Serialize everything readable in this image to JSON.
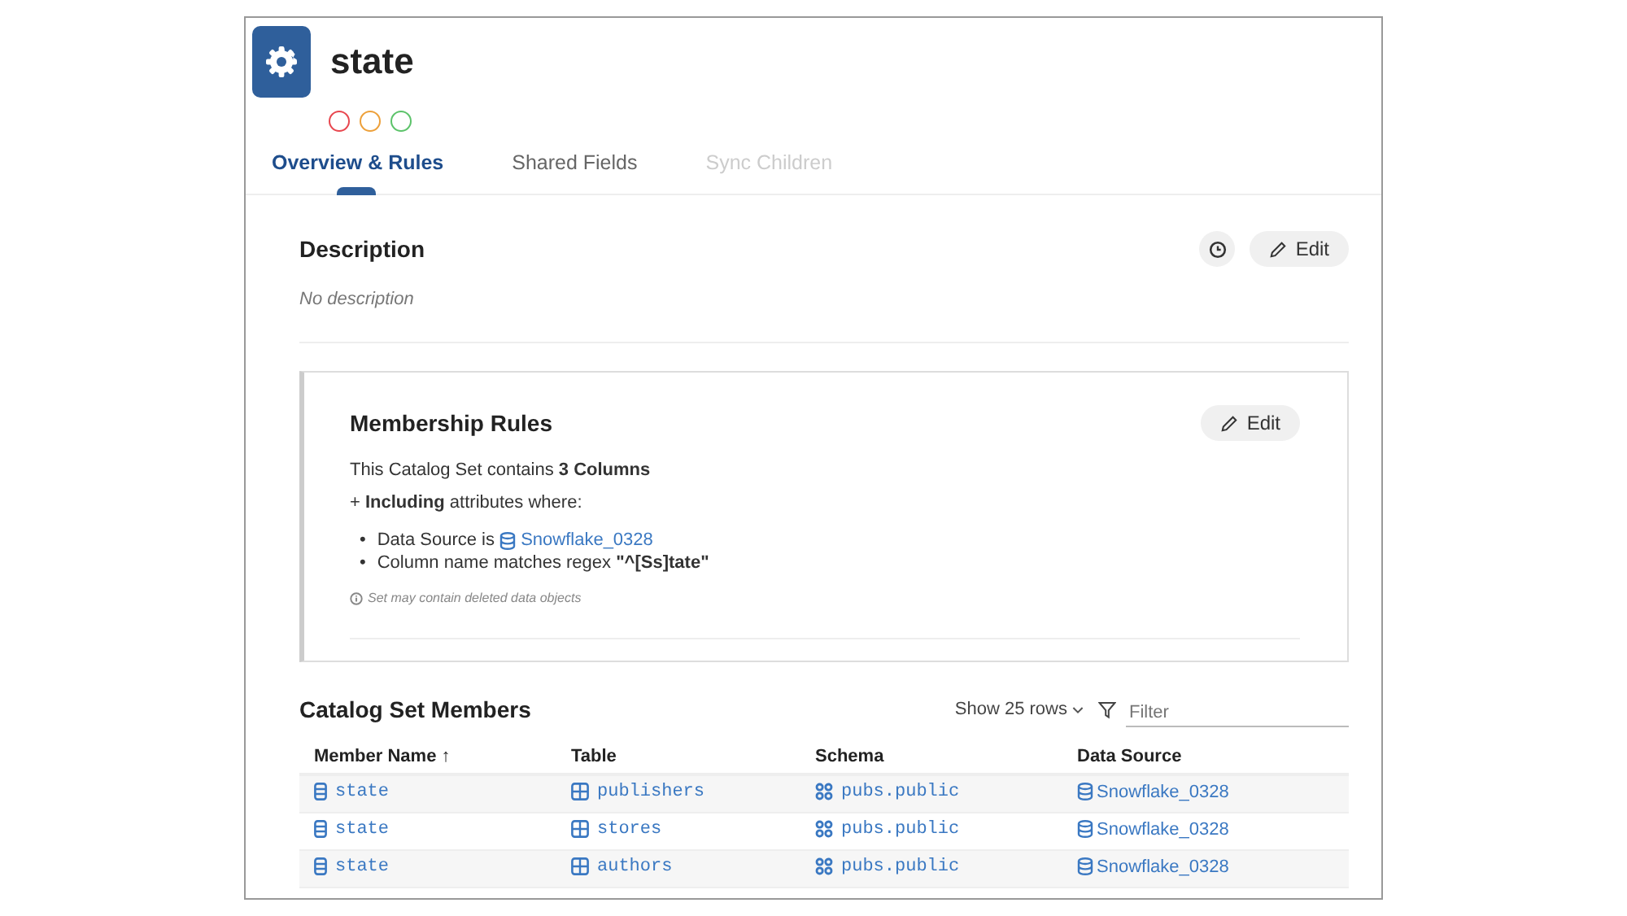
{
  "header": {
    "title": "state",
    "status_dots": [
      {
        "color": "#e8474f"
      },
      {
        "color": "#eda03a"
      },
      {
        "color": "#5cc36a"
      }
    ]
  },
  "tabs": [
    {
      "label": "Overview & Rules",
      "selected": true,
      "disabled": false
    },
    {
      "label": "Shared Fields",
      "selected": false,
      "disabled": false
    },
    {
      "label": "Sync Children",
      "selected": false,
      "disabled": true
    }
  ],
  "description": {
    "heading": "Description",
    "edit_button": "Edit",
    "text": "No description"
  },
  "membership_rules": {
    "heading": "Membership Rules",
    "edit_button": "Edit",
    "summary": "This Catalog Set contains **3 Columns**",
    "including": "+ **Including** attributes where:",
    "conditions": [
      {
        "bullet": "•",
        "text": "Data Source is ",
        "link": "Snowflake_0328"
      },
      {
        "bullet": "•",
        "text": "Column name matches regex **\"^[Ss]tate\"**"
      }
    ],
    "note": "Set may contain deleted data objects"
  },
  "members": {
    "heading": "Catalog Set Members",
    "rows_menu": "Show 25 rows",
    "filter_placeholder": "Filter",
    "sort_mark": "↑",
    "columns": [
      "Member Name",
      "Table",
      "Schema",
      "Data Source"
    ],
    "rows": [
      [
        "state",
        "publishers",
        "pubs.public",
        "Snowflake_0328"
      ],
      [
        "state",
        "stores",
        "pubs.public",
        "Snowflake_0328"
      ],
      [
        "state",
        "authors",
        "pubs.public",
        "Snowflake_0328"
      ]
    ]
  }
}
